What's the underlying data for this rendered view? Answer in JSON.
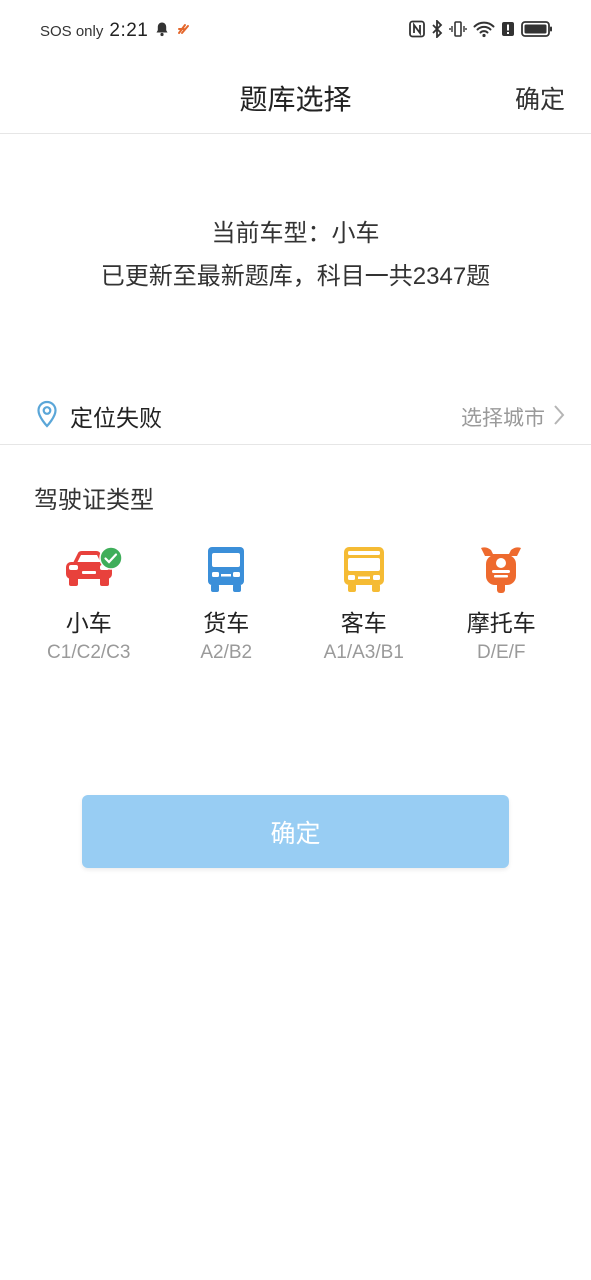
{
  "status_bar": {
    "carrier": "SOS only",
    "time": "2:21"
  },
  "header": {
    "title": "题库选择",
    "confirm_label": "确定"
  },
  "info": {
    "current_type": "当前车型：小车",
    "update_text": "已更新至最新题库，科目一共2347题"
  },
  "location": {
    "status": "定位失败",
    "select_city_label": "选择城市"
  },
  "license_section": {
    "title": "驾驶证类型",
    "items": [
      {
        "name": "小车",
        "code": "C1/C2/C3",
        "color": "#e8413c",
        "selected": true
      },
      {
        "name": "货车",
        "code": "A2/B2",
        "color": "#3b8fd9",
        "selected": false
      },
      {
        "name": "客车",
        "code": "A1/A3/B1",
        "color": "#f5bb34",
        "selected": false
      },
      {
        "name": "摩托车",
        "code": "D/E/F",
        "color": "#ee6a2e",
        "selected": false
      }
    ]
  },
  "confirm_button": {
    "label": "确定",
    "color": "#98cdf3"
  },
  "colors": {
    "accent_check": "#3fae5a",
    "location_icon": "#5aa6d8"
  }
}
